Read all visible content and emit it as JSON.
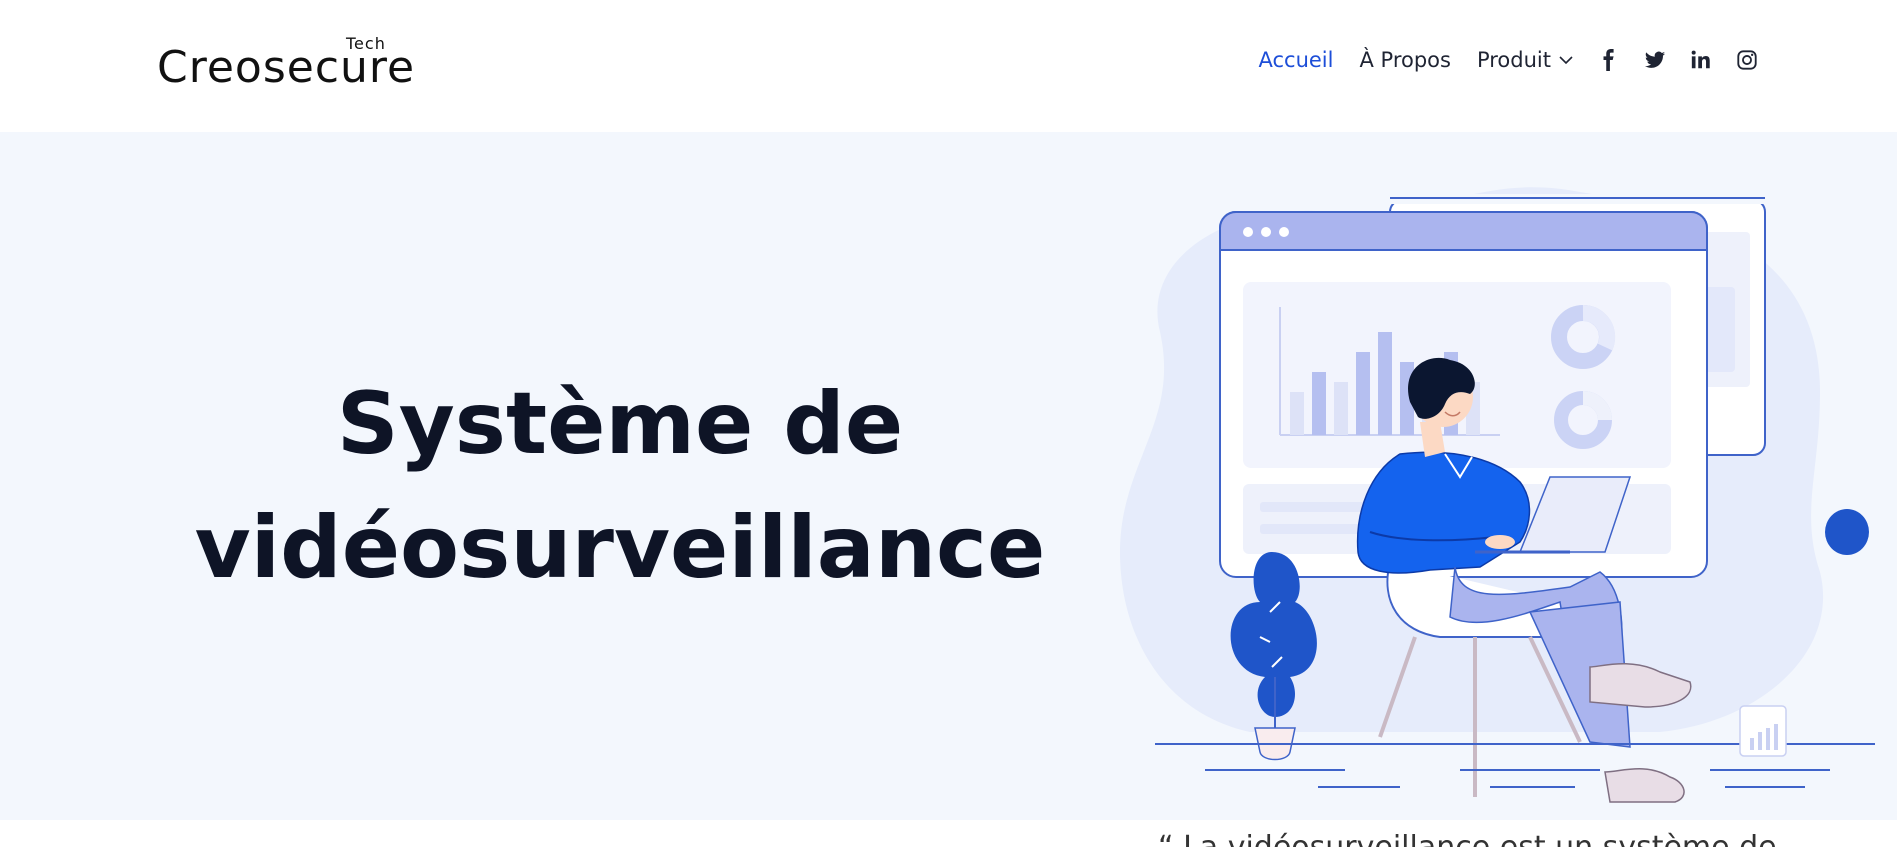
{
  "logo": {
    "main": "Creosecure",
    "sup": "Tech"
  },
  "nav": {
    "items": [
      {
        "label": "Accueil",
        "active": true
      },
      {
        "label": "À Propos",
        "active": false
      },
      {
        "label": "Produit",
        "active": false,
        "has_dropdown": true
      }
    ],
    "social": [
      "facebook-icon",
      "twitter-icon",
      "linkedin-icon",
      "instagram-icon"
    ]
  },
  "hero": {
    "title_line1": "Système de",
    "title_line2": "vidéosurveillance"
  },
  "quote": {
    "text": "“ La vidéosurveillance est un système de"
  },
  "colors": {
    "accent": "#1d4ed8",
    "hero_bg": "#f3f7fd",
    "title": "#0e1426",
    "illustration_blue": "#1f55c9",
    "illustration_lavender": "#aab4ee"
  }
}
